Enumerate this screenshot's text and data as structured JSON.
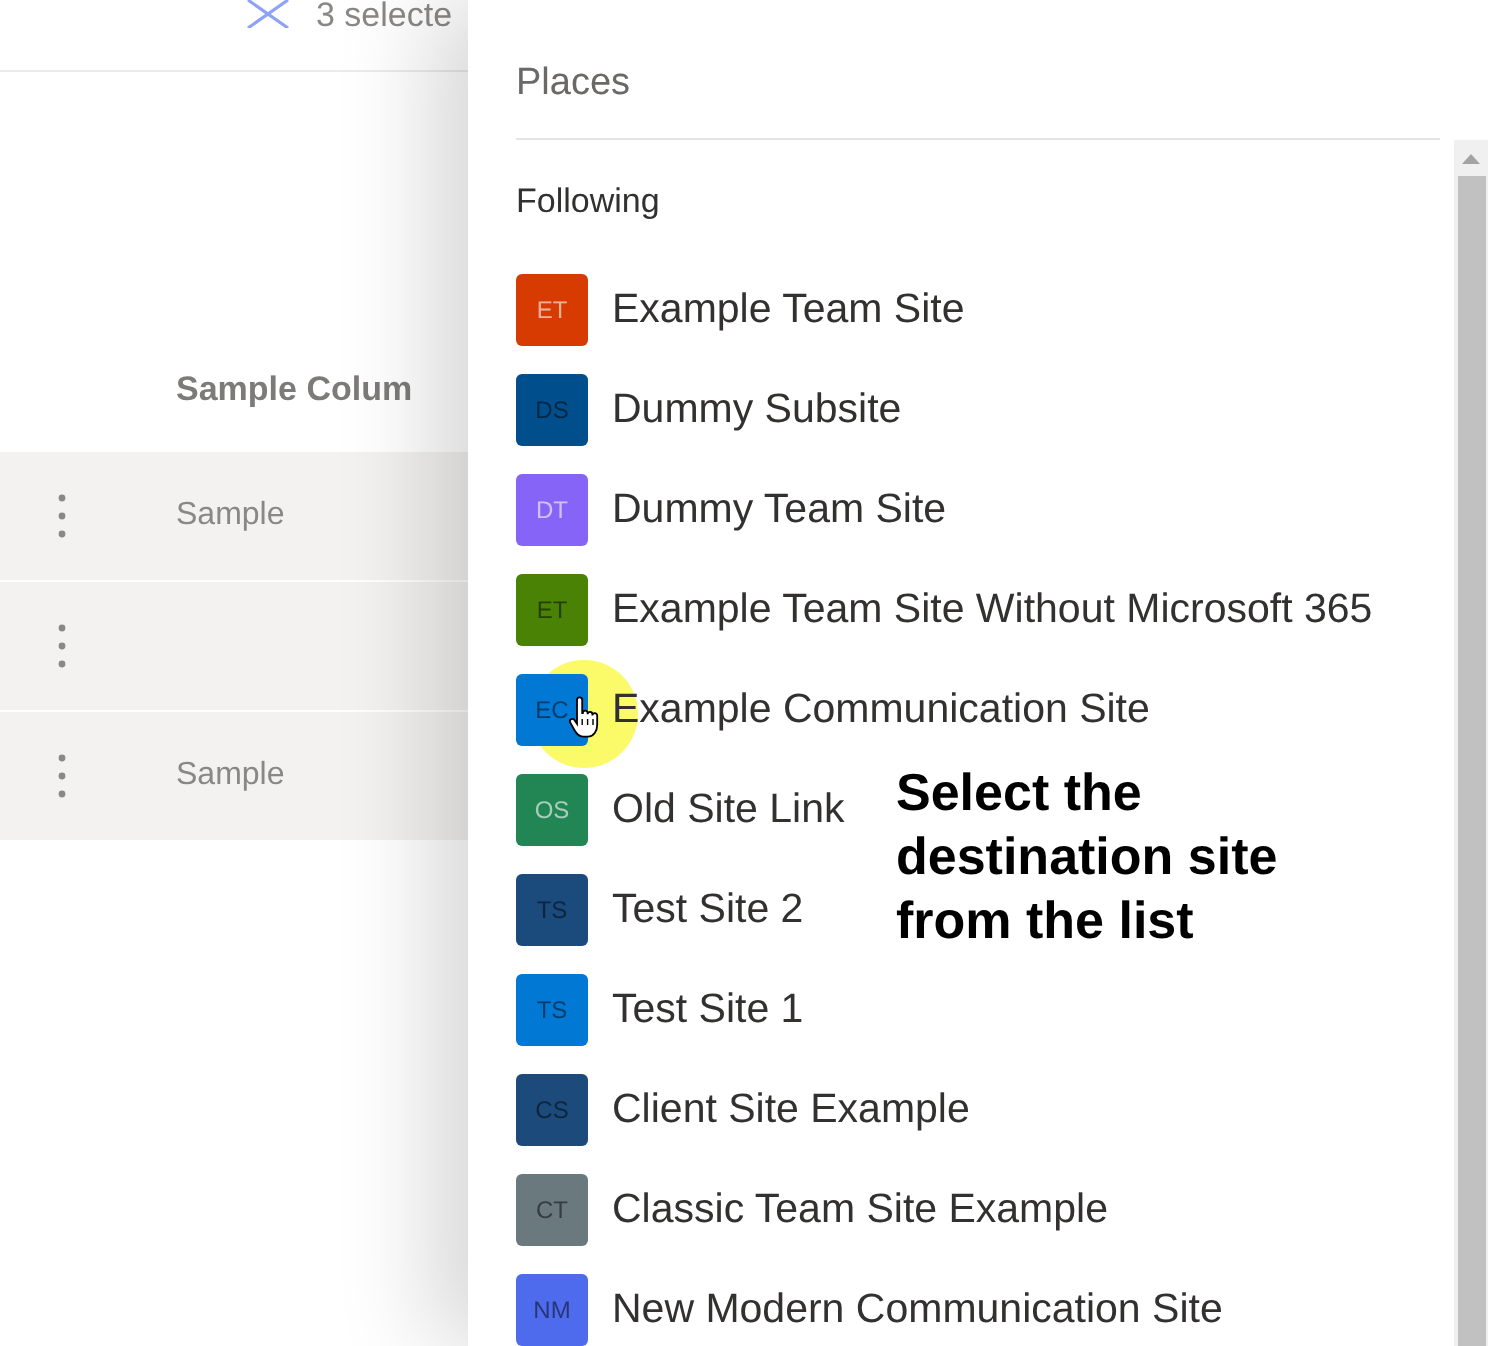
{
  "background_page": {
    "selection_count": "3 selecte",
    "column_header": "Sample Colum",
    "rows": [
      {
        "column_1": "Sample"
      },
      {},
      {
        "column_1": "Sample"
      }
    ]
  },
  "panel": {
    "title": "Places",
    "section": "Following",
    "sites": [
      {
        "initials": "ET",
        "name": "Example Team Site",
        "color": "#d83b01",
        "light_initials": true,
        "hovered": false
      },
      {
        "initials": "DS",
        "name": "Dummy Subsite",
        "color": "#004e8c",
        "light_initials": false,
        "hovered": false
      },
      {
        "initials": "DT",
        "name": "Dummy Team Site",
        "color": "#8764f8",
        "light_initials": true,
        "hovered": false
      },
      {
        "initials": "ET",
        "name": "Example Team Site Without Microsoft 365",
        "color": "#498205",
        "light_initials": false,
        "hovered": false
      },
      {
        "initials": "EC",
        "name": "Example Communication Site",
        "color": "#0078d4",
        "light_initials": false,
        "hovered": true
      },
      {
        "initials": "OS",
        "name": "Old Site Link",
        "color": "#218654",
        "light_initials": true,
        "hovered": false
      },
      {
        "initials": "TS",
        "name": "Test Site 2",
        "color": "#1b4a7c",
        "light_initials": false,
        "hovered": false
      },
      {
        "initials": "TS",
        "name": "Test Site 1",
        "color": "#0078d4",
        "light_initials": false,
        "hovered": false
      },
      {
        "initials": "CS",
        "name": "Client Site Example",
        "color": "#1c4a7a",
        "light_initials": false,
        "hovered": false
      },
      {
        "initials": "CT",
        "name": "Classic Team Site Example",
        "color": "#69797e",
        "light_initials": false,
        "hovered": false
      },
      {
        "initials": "NM",
        "name": "New Modern Communication Site",
        "color": "#4f6bed",
        "light_initials": false,
        "hovered": false
      }
    ]
  },
  "annotation": {
    "text": "Select the destination site from the list"
  }
}
